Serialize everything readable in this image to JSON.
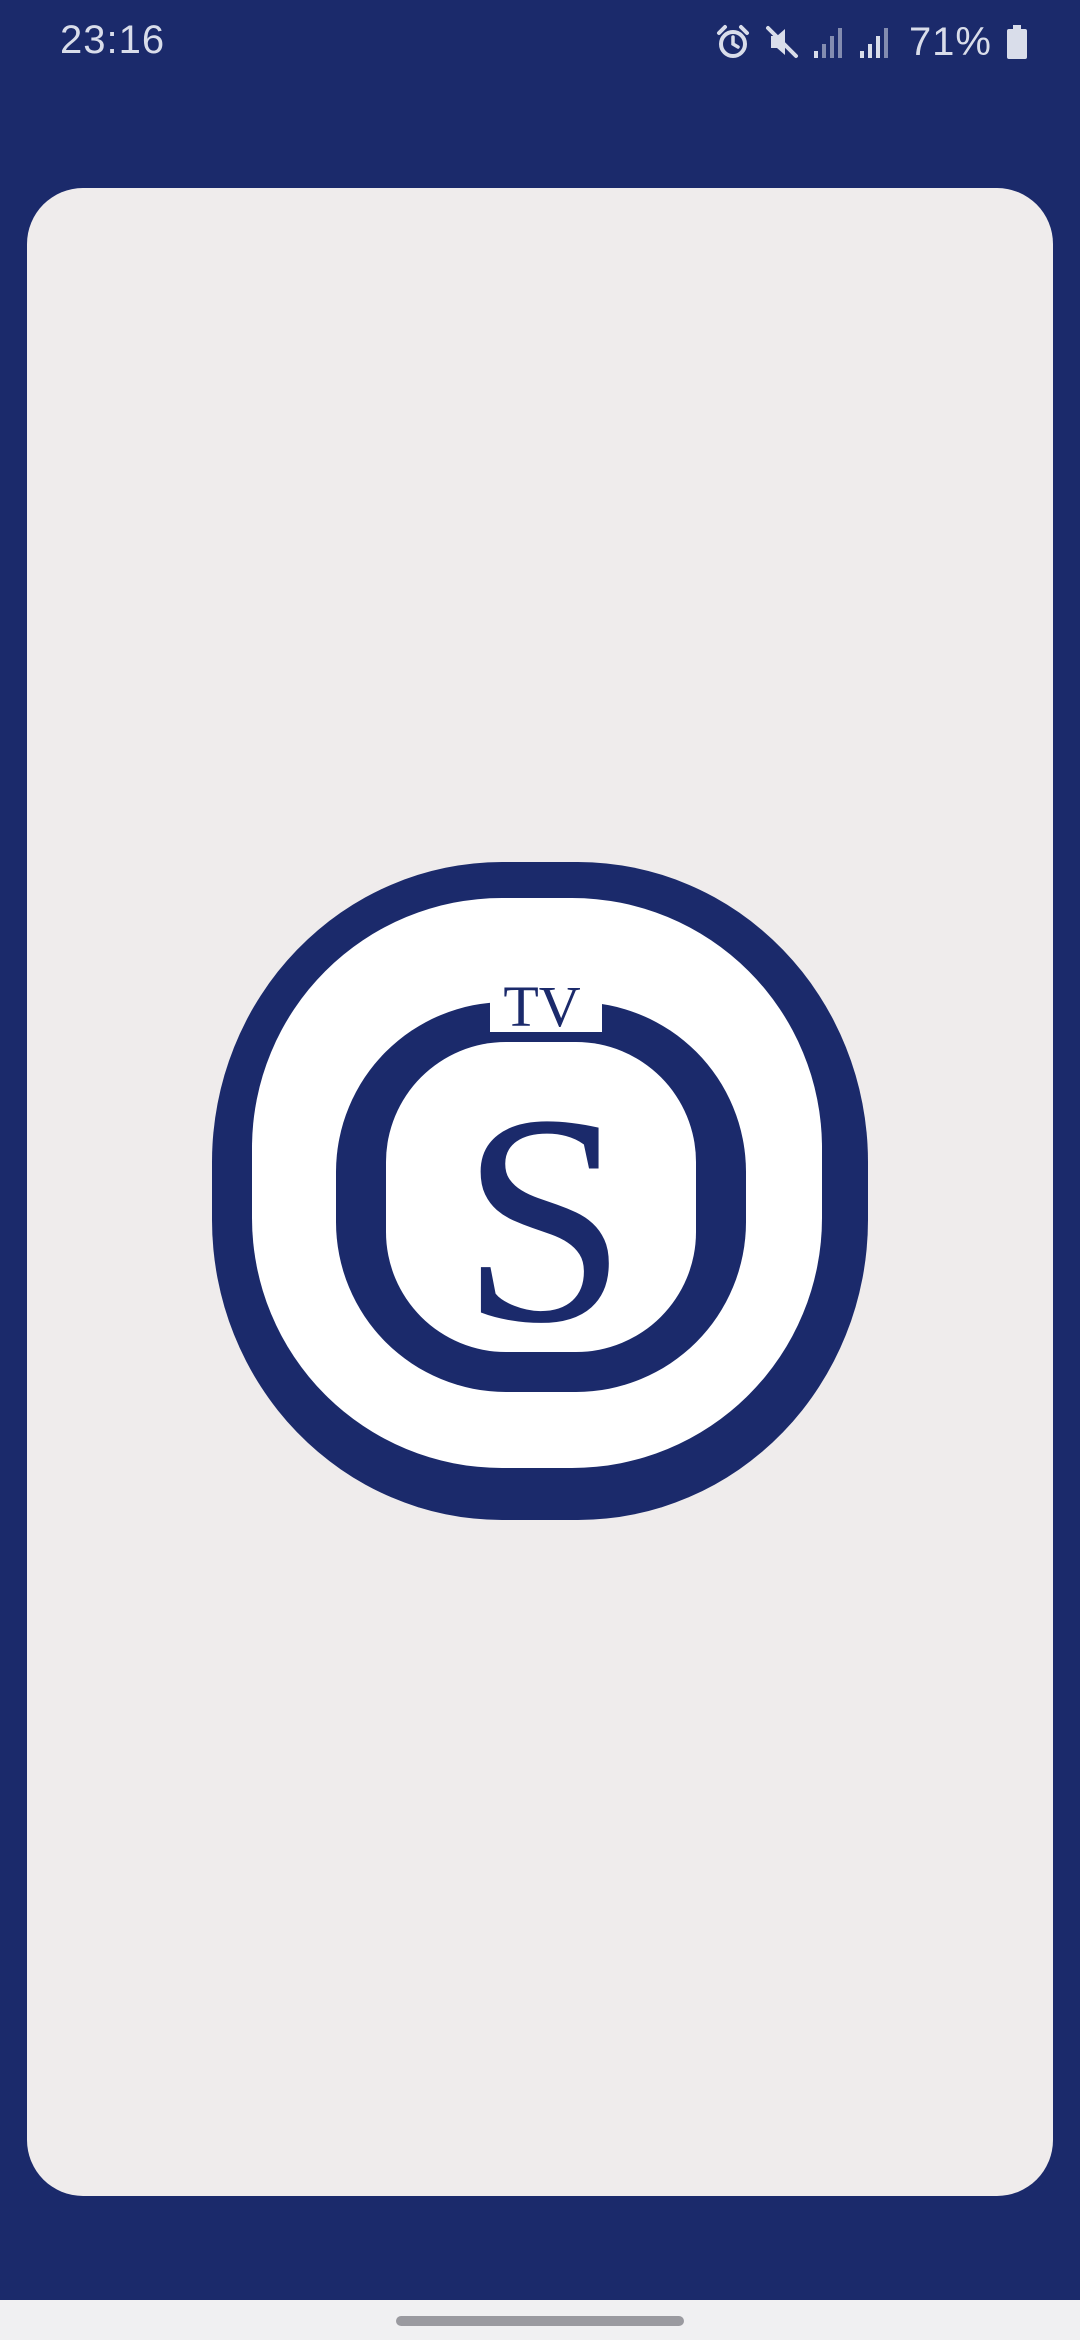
{
  "status_bar": {
    "time": "23:16",
    "battery": "71%",
    "icons": [
      "alarm-icon",
      "mute-icon",
      "signal-icon",
      "signal-icon",
      "battery-icon"
    ]
  },
  "logo": {
    "small_text": "TV",
    "letter": "S",
    "color": "#1b2a6b"
  },
  "colors": {
    "background": "#1b2a6b",
    "card": "#efecec",
    "nav_bar": "#f0f0f2"
  }
}
